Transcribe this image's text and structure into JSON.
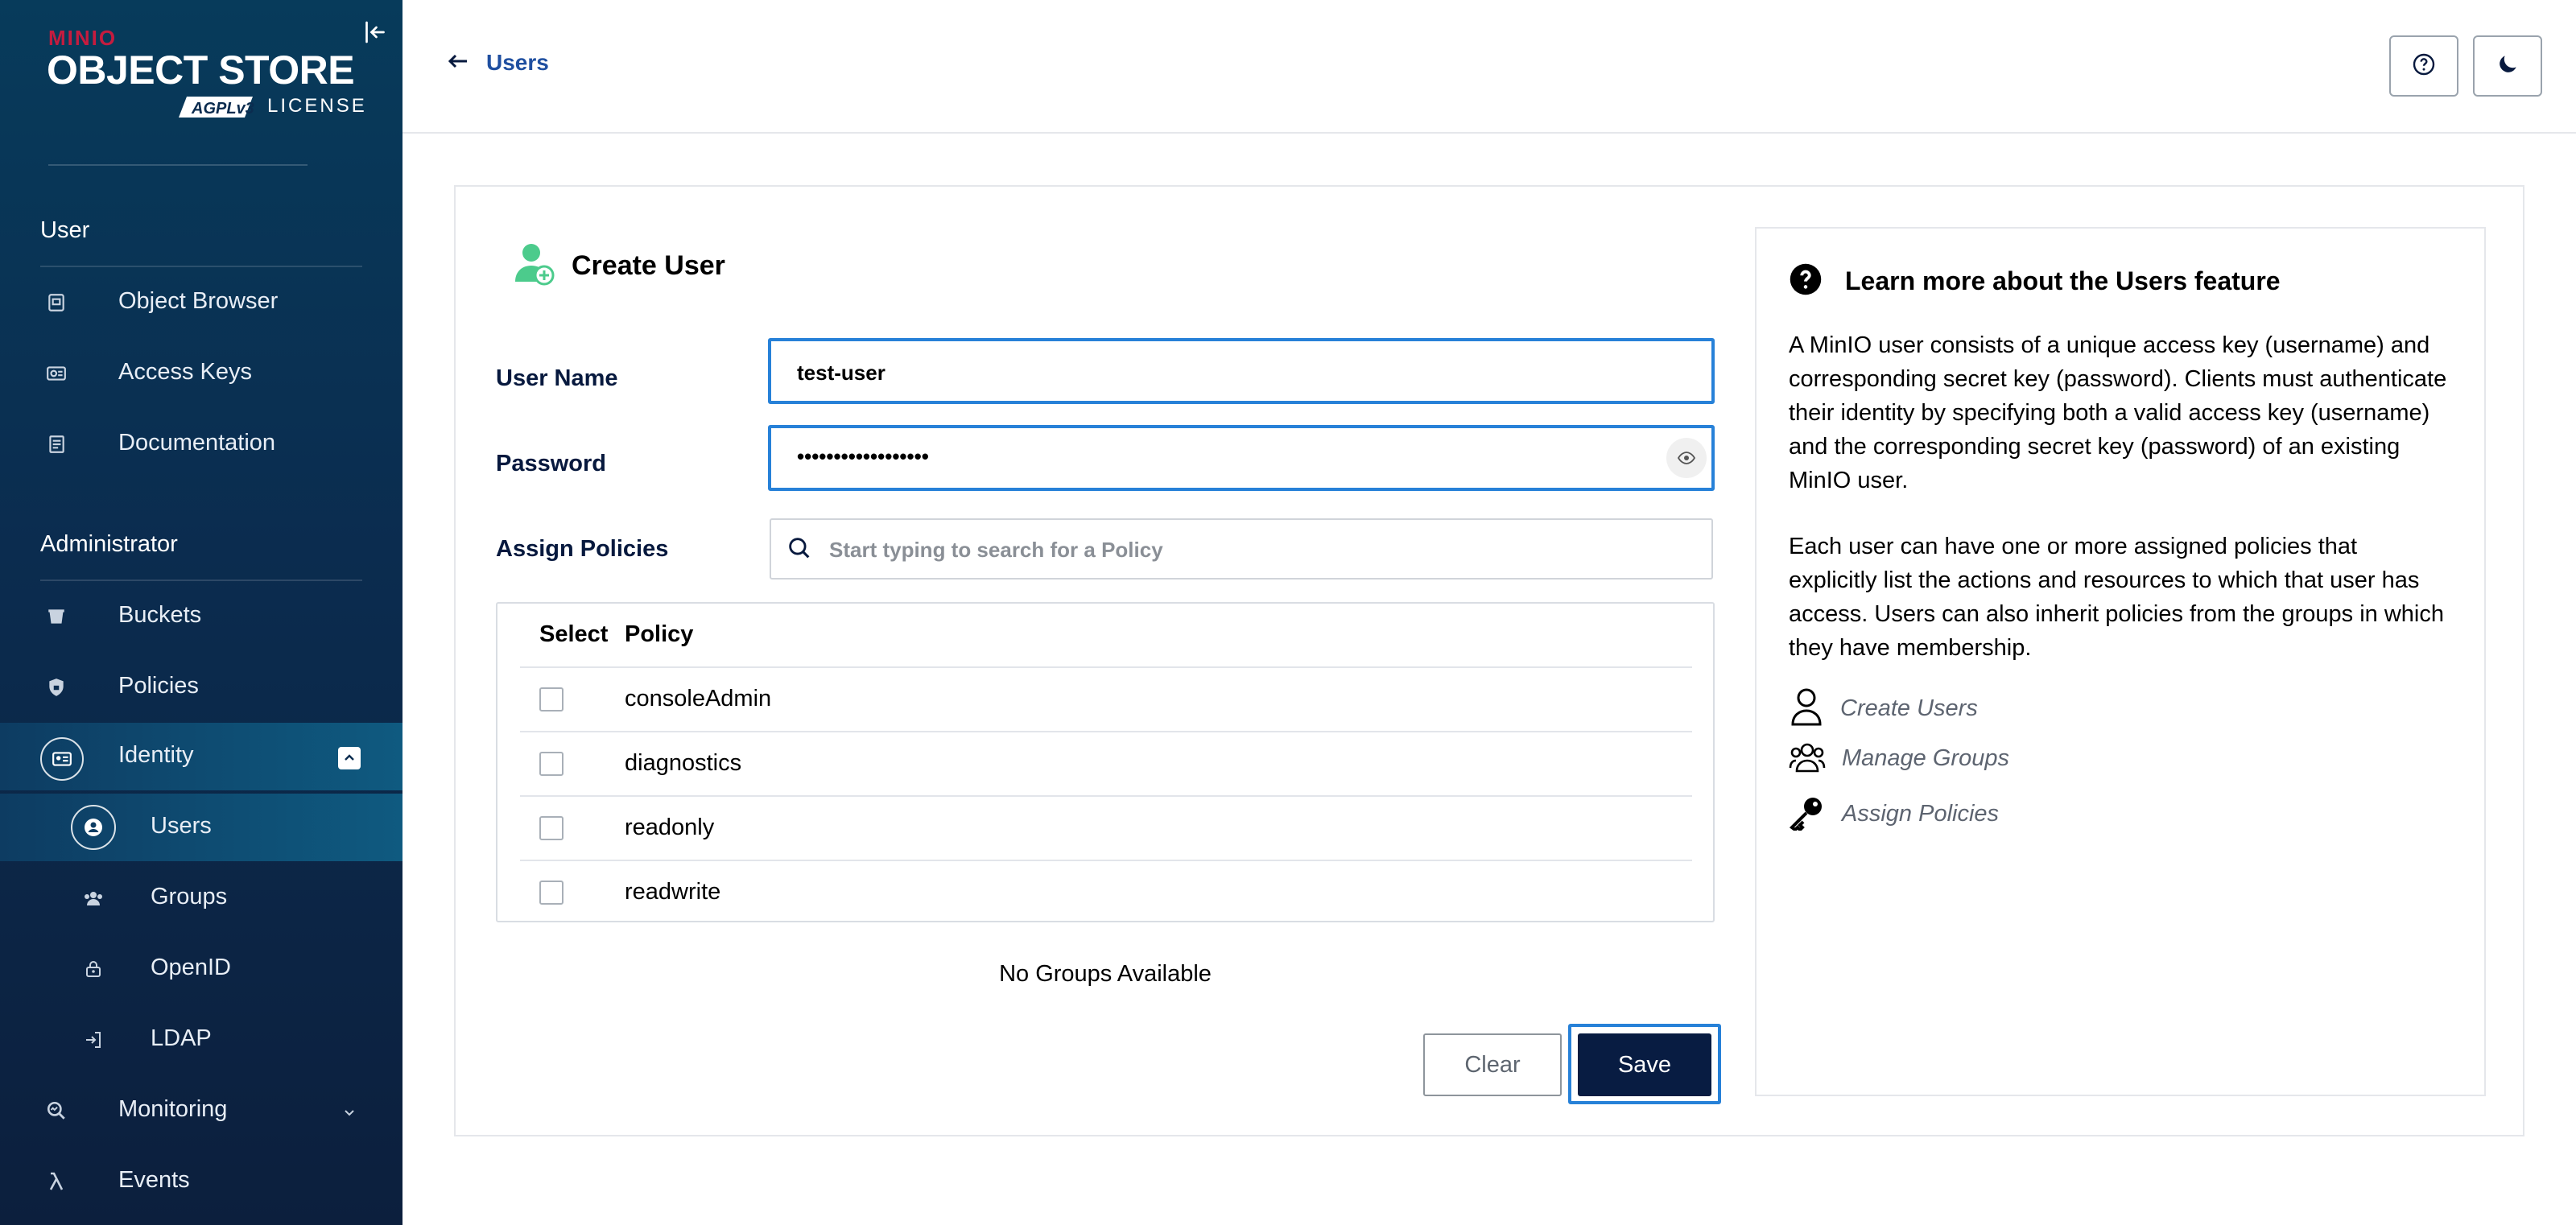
{
  "brand": {
    "minio": "MINIO",
    "product": "OBJECT STORE",
    "agpl": "AGPLv3",
    "license": "LICENSE"
  },
  "sidebar": {
    "user_section": "User",
    "user_items": [
      {
        "label": "Object Browser",
        "icon": "object-browser-icon"
      },
      {
        "label": "Access Keys",
        "icon": "access-keys-icon"
      },
      {
        "label": "Documentation",
        "icon": "documentation-icon"
      }
    ],
    "admin_section": "Administrator",
    "admin_items": [
      {
        "label": "Buckets",
        "icon": "buckets-icon"
      },
      {
        "label": "Policies",
        "icon": "policies-icon"
      },
      {
        "label": "Identity",
        "icon": "identity-icon",
        "expanded": true
      },
      {
        "label": "Users",
        "icon": "user-icon",
        "active": true
      },
      {
        "label": "Groups",
        "icon": "groups-icon"
      },
      {
        "label": "OpenID",
        "icon": "openid-icon"
      },
      {
        "label": "LDAP",
        "icon": "ldap-icon"
      },
      {
        "label": "Monitoring",
        "icon": "monitoring-icon",
        "expanded": false
      },
      {
        "label": "Events",
        "icon": "lambda-icon"
      }
    ]
  },
  "header": {
    "back_label": "Users"
  },
  "form": {
    "title": "Create User",
    "username_label": "User Name",
    "username_value": "test-user",
    "password_label": "Password",
    "password_value": "••••••••••••••••••",
    "policies_label": "Assign Policies",
    "policy_search_placeholder": "Start typing to search for a Policy",
    "table_headers": {
      "select": "Select",
      "policy": "Policy"
    },
    "policies": [
      "consoleAdmin",
      "diagnostics",
      "readonly",
      "readwrite"
    ],
    "no_groups": "No Groups Available",
    "clear_label": "Clear",
    "save_label": "Save"
  },
  "help": {
    "title": "Learn more about the Users feature",
    "p1": "A MinIO user consists of a unique access key (username) and corresponding secret key (password). Clients must authenticate their identity by specifying both a valid access key (username) and the corresponding secret key (password) of an existing MinIO user.",
    "p2": "Each user can have one or more assigned policies that explicitly list the actions and resources to which that user has access. Users can also inherit policies from the groups in which they have membership.",
    "links": [
      "Create Users",
      "Manage Groups",
      "Assign Policies"
    ]
  },
  "colors": {
    "accent": "#2781d8",
    "primary": "#081c42",
    "brand_red": "#c51c3f",
    "sidebar_bg": "#0b2c4f"
  }
}
